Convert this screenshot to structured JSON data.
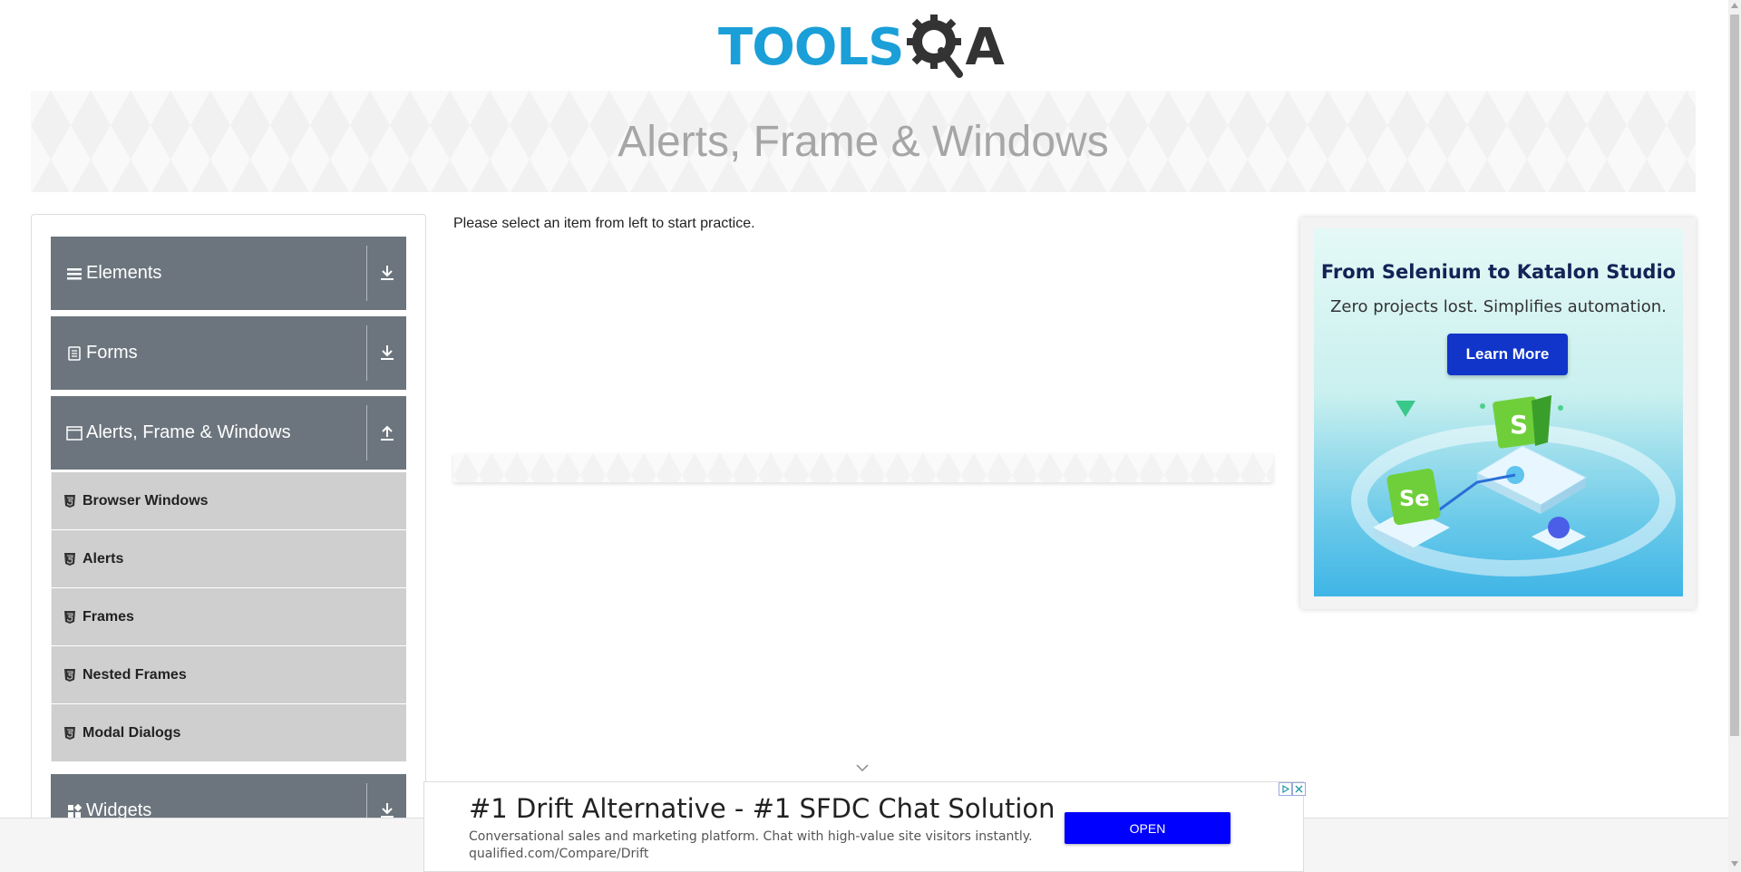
{
  "header": {
    "logo_text": "TOOLS",
    "logo_suffix": "A",
    "banner_title": "Alerts, Frame & Windows"
  },
  "sidebar": {
    "groups": [
      {
        "label": "Elements",
        "icon": "list-icon",
        "expanded": false
      },
      {
        "label": "Forms",
        "icon": "document-icon",
        "expanded": false
      },
      {
        "label": "Alerts, Frame & Windows",
        "icon": "window-icon",
        "expanded": true
      },
      {
        "label": "Widgets",
        "icon": "widgets-icon",
        "expanded": false
      }
    ],
    "items": [
      {
        "label": "Browser Windows",
        "icon": "html5-icon"
      },
      {
        "label": "Alerts",
        "icon": "html5-icon"
      },
      {
        "label": "Frames",
        "icon": "html5-icon"
      },
      {
        "label": "Nested Frames",
        "icon": "html5-icon"
      },
      {
        "label": "Modal Dialogs",
        "icon": "html5-icon"
      }
    ]
  },
  "main": {
    "instruction": "Please select an item from left to start practice."
  },
  "right_ad": {
    "headline": "From Selenium to Katalon Studio",
    "subtext": "Zero projects lost. Simplifies automation.",
    "button_label": "Learn More",
    "badge_s": "S",
    "badge_se": "Se"
  },
  "bottom_ad": {
    "headline": "#1 Drift Alternative - #1 SFDC Chat Solution",
    "description": "Conversational sales and marketing platform. Chat with high-value site visitors instantly.",
    "url": "qualified.com/Compare/Drift",
    "button_label": "OPEN"
  },
  "colors": {
    "accent_blue": "#1b9fd8",
    "sidebar_header": "#6c757d",
    "sidebar_item": "#cfcfcf",
    "ad_button": "#1035c8",
    "open_button": "#0000ff"
  }
}
